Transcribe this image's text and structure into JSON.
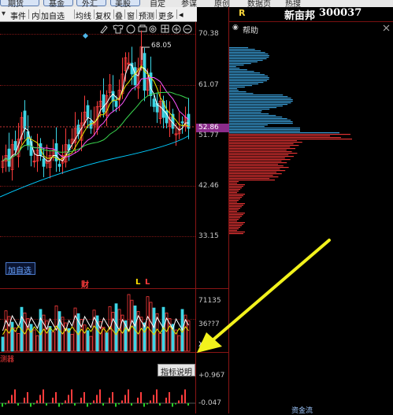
{
  "top_menu": {
    "items": [
      "期货",
      "基金",
      "外汇",
      "美股",
      "自定",
      "参谋",
      "原创",
      "数据页",
      "热搜"
    ]
  },
  "toolbar": {
    "items": [
      "事件",
      "内",
      "加自选",
      "均线",
      "复权",
      "叠",
      "窗",
      "预测",
      "更多"
    ],
    "dropdown_label": "▾",
    "arrow_label": "◂"
  },
  "header": {
    "tag": "R",
    "stock_name": "新亩邦",
    "stock_code": "300037",
    "help_label": "帮助"
  },
  "main_chart": {
    "price_axis": [
      "70.38",
      "61.07",
      "52.86",
      "51.77",
      "42.46",
      "33.15"
    ],
    "high_marker": "68.05",
    "current_price": "52.86",
    "add_watchlist": "加自选",
    "event_markers": [
      "财",
      "L",
      "L"
    ]
  },
  "volume_chart": {
    "axis": [
      "71135",
      "36???",
      "X10"
    ],
    "axis_top": "71135",
    "axis_mid": "36??7",
    "axis_unit": "X10"
  },
  "indicator_panel": {
    "title": "指标说明",
    "left_label": "测器",
    "axis_top": "+0.967",
    "axis_bottom": "-0.047",
    "bottom_text": "资金流"
  },
  "colors": {
    "up": "#ff3c3c",
    "down": "#3cd6e6",
    "ma_yellow": "#e6e600",
    "ma_white": "#ffffff",
    "ma_magenta": "#ff55ff",
    "ma_cyan": "#00ccff",
    "arrow": "#f2f21c",
    "price_tag": "#8b2c8b"
  },
  "icons": [
    "draw-icon",
    "shirt-icon",
    "circle-icon",
    "print-icon",
    "gear-icon",
    "grid-icon",
    "plus-icon",
    "minus-icon"
  ]
}
